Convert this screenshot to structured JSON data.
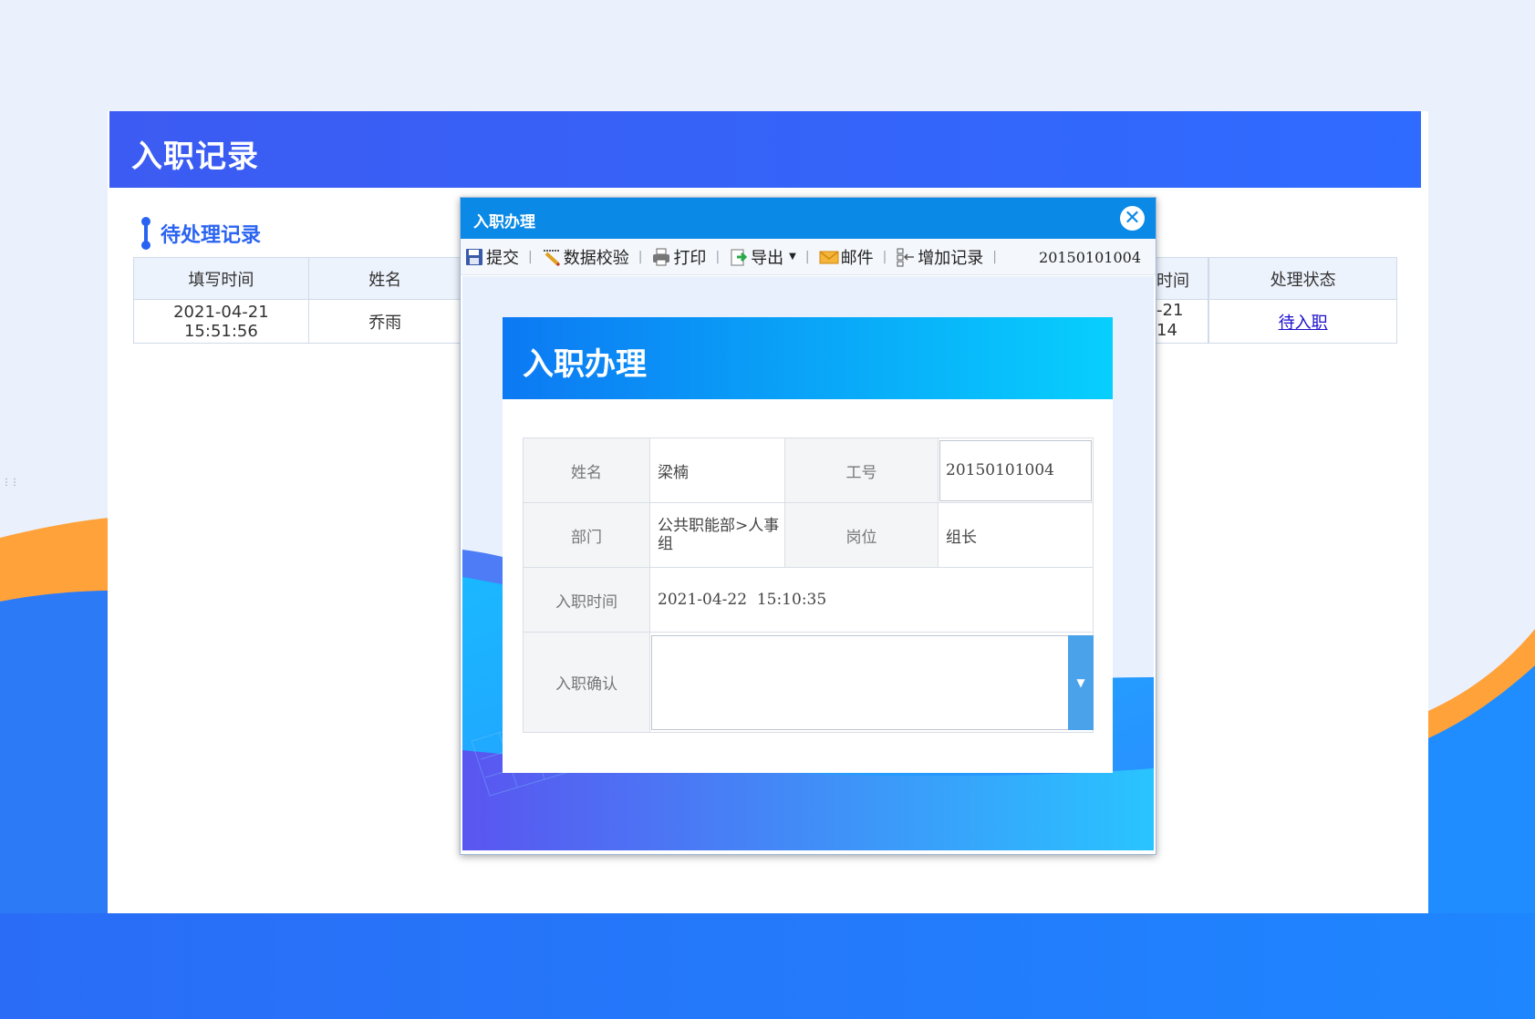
{
  "page": {
    "title": "入职记录",
    "section_title": "待处理记录",
    "table": {
      "columns": [
        "填写时间",
        "姓名",
        "",
        "时间",
        "处理状态"
      ],
      "rows": [
        {
          "fill_time": "2021-04-21 15:51:56",
          "name": "乔雨",
          "time_partial_1": "-21",
          "time_partial_2": "14",
          "status_link": "待入职"
        }
      ]
    }
  },
  "modal": {
    "title": "入职办理",
    "toolbar": {
      "submit": "提交",
      "validate": "数据校验",
      "print": "打印",
      "export": "导出",
      "mail": "邮件",
      "add_record": "增加记录",
      "record_code": "20150101004"
    },
    "form": {
      "header_title": "入职办理",
      "name_label": "姓名",
      "name_value": "梁楠",
      "emp_no_label": "工号",
      "emp_no_value": "20150101004",
      "dept_label": "部门",
      "dept_value": "公共职能部>人事组",
      "position_label": "岗位",
      "position_value": "组长",
      "entry_time_label": "入职时间",
      "entry_time_value": "2021-04-22  15:10:35",
      "confirm_label": "入职确认",
      "confirm_value": ""
    }
  },
  "colors": {
    "header_blue": "#2f6bff",
    "dialog_title_blue": "#0a8ae6",
    "accent_orange": "#ffa23a",
    "link": "#1a0dcc"
  }
}
